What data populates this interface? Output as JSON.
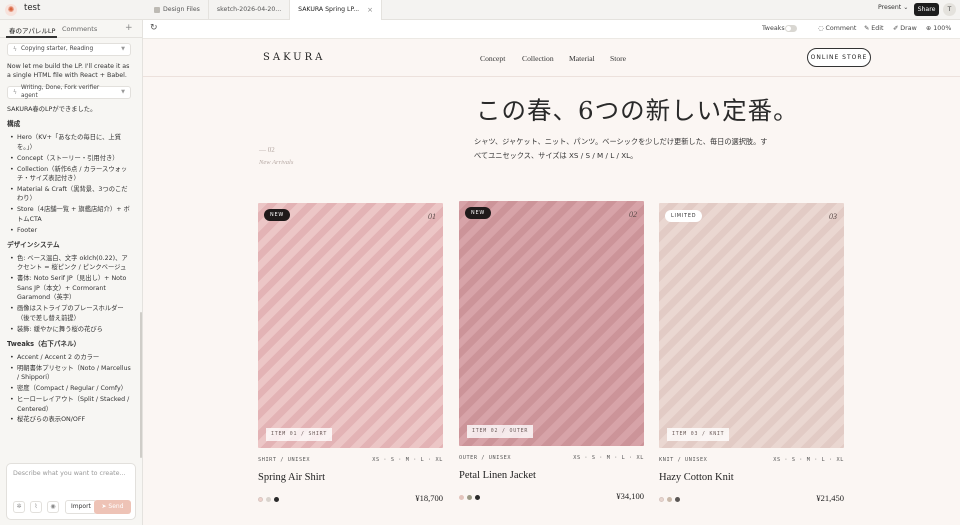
{
  "app": {
    "project_title": "test",
    "tabs": [
      {
        "label": "Design Files"
      },
      {
        "label": "sketch-2026-04-20..."
      },
      {
        "label": "SAKURA Spring LP..."
      }
    ],
    "tab_close": "×",
    "present_label": "Present",
    "share_label": "Share",
    "avatar_initial": "T"
  },
  "left_panel": {
    "tabs": [
      "春のアパレルLP",
      "Comments"
    ],
    "add": "+",
    "chip1": "Copying starter, Reading",
    "msg1": "Now let me build the LP. I'll create it as a single HTML file with React + Babel.",
    "chip2": "Writing, Done, Fork verifier agent",
    "msg2": "SAKURA春のLPができました。",
    "sections": [
      {
        "heading": "構成",
        "items": [
          "Hero（KV+「あなたの毎日に、上質を。」）",
          "Concept（ストーリー・引用付き）",
          "Collection（新作6点 / カラースウォッチ・サイズ表記付き）",
          "Material & Craft（黒背景、3つのこだわり）",
          "Store（4店舗一覧 + 旗艦店紹介）+ ボトムCTA",
          "Footer"
        ]
      },
      {
        "heading": "デザインシステム",
        "items": [
          "色: ベース温白、文字 oklch(0.22)、アクセント = 桜ピンク / ピンクベージュ",
          "書体: Noto Serif JP（見出し）+ Noto Sans JP（本文）+ Cormorant Garamond（英字）",
          "画像はストライプのプレースホルダー（後で差し替え前提）",
          "装飾: 緩やかに舞う桜の花びら"
        ]
      },
      {
        "heading": "Tweaks（右下パネル）",
        "items": [
          "Accent / Accent 2 のカラー",
          "明朝書体プリセット（Noto / Marcellus / Shippori）",
          "密度（Compact / Regular / Comfy）",
          "ヒーローレイアウト（Split / Stacked / Centered）",
          "桜花びらの表示ON/OFF"
        ]
      }
    ],
    "composer_placeholder": "Describe what you want to create...",
    "import_label": "Import",
    "send_label": "Send"
  },
  "toolbar": {
    "tweaks": "Tweaks",
    "comment": "Comment",
    "edit": "Edit",
    "draw": "Draw",
    "zoom": "100%"
  },
  "site": {
    "brand": "SAKURA",
    "nav": [
      "Concept",
      "Collection",
      "Material",
      "Store"
    ],
    "store_button": "ONLINE STORE",
    "hero_title": "この春、6つの新しい定番。",
    "hero_text": "シャツ、ジャケット、ニット、パンツ。ベーシックを少しだけ更新した、毎日の選択肢。すべてユニセックス、サイズは XS / S / M / L / XL。",
    "section_num": "— 02",
    "section_label": "New Arrivals",
    "products": [
      {
        "badge": "NEW",
        "badge_style": "new",
        "num": "01",
        "item_label": "ITEM 01 / SHIRT",
        "category": "SHIRT / UNISEX",
        "sizes": "XS · S · M · L · XL",
        "name": "Spring Air Shirt",
        "price": "¥18,700",
        "stripe_a": "#ecc6c6",
        "stripe_b": "#e3b3b5",
        "swatches": [
          "#f0d2cc",
          "#d9d3cd",
          "#2a2a2a"
        ]
      },
      {
        "badge": "NEW",
        "badge_style": "new",
        "num": "02",
        "item_label": "ITEM 02 / OUTER",
        "category": "OUTER / UNISEX",
        "sizes": "XS · S · M · L · XL",
        "name": "Petal Linen Jacket",
        "price": "¥34,100",
        "stripe_a": "#d7a3a8",
        "stripe_b": "#cc9499",
        "swatches": [
          "#e3c4bc",
          "#9c9a86",
          "#2a2a2a"
        ]
      },
      {
        "badge": "LIMITED",
        "badge_style": "limited",
        "num": "03",
        "item_label": "ITEM 03 / KNIT",
        "category": "KNIT / UNISEX",
        "sizes": "XS · S · M · L · XL",
        "name": "Hazy Cotton Knit",
        "price": "¥21,450",
        "stripe_a": "#ead7d1",
        "stripe_b": "#e2cbc5",
        "swatches": [
          "#e9d6cf",
          "#c9b9aa",
          "#5a5654"
        ]
      }
    ]
  }
}
